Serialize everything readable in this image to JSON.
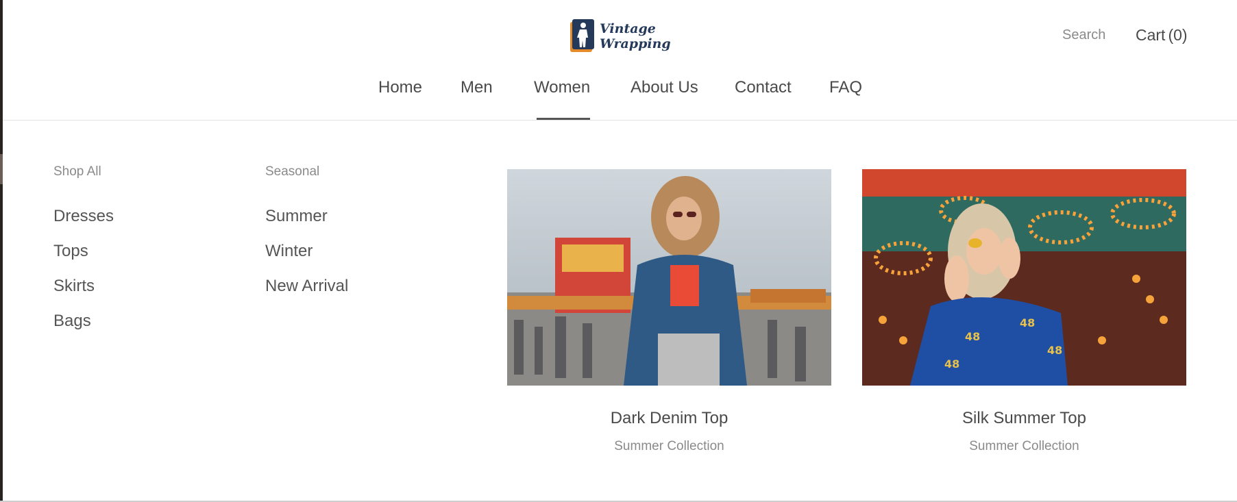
{
  "brand": {
    "line1": "Vintage",
    "line2": "Wrapping",
    "logo_icon": "person-silhouette-icon",
    "color": "#253a5a",
    "accent": "#e58b2a"
  },
  "header": {
    "search_label": "Search",
    "cart_label": "Cart",
    "cart_count": "(0)"
  },
  "nav": {
    "items": [
      {
        "label": "Home"
      },
      {
        "label": "Men"
      },
      {
        "label": "Women",
        "active": true
      },
      {
        "label": "About Us"
      },
      {
        "label": "Contact"
      },
      {
        "label": "FAQ"
      }
    ]
  },
  "mega_menu": {
    "columns": [
      {
        "heading": "Shop All",
        "links": [
          "Dresses",
          "Tops",
          "Skirts",
          "Bags"
        ]
      },
      {
        "heading": "Seasonal",
        "links": [
          "Summer",
          "Winter",
          "New Arrival"
        ]
      }
    ],
    "products": [
      {
        "title": "Dark Denim Top",
        "subtitle": "Summer Collection"
      },
      {
        "title": "Silk Summer Top",
        "subtitle": "Summer Collection"
      }
    ]
  }
}
